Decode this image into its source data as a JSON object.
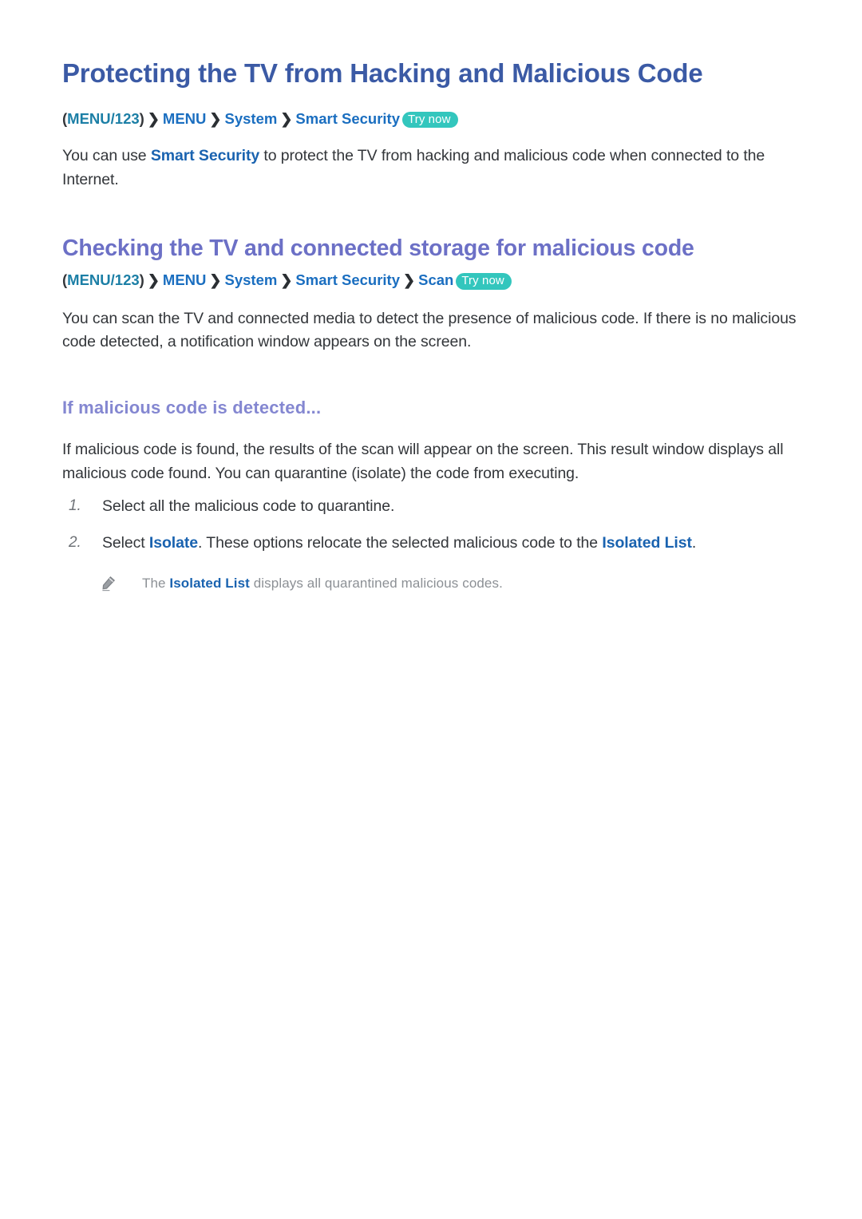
{
  "colors": {
    "title_blue": "#3b5aa5",
    "section_purple": "#6c70c6",
    "subsection_purple": "#8487d1",
    "breadcrumb_teal": "#1c7fa6",
    "breadcrumb_blue": "#1a6ec0",
    "link_blue": "#1a63b0",
    "body_text": "#33363a",
    "note_text": "#8c9095",
    "badge_teal": "#33c6bd",
    "page_background": "#ffffff"
  },
  "title": "Protecting the TV from Hacking and Malicious Code",
  "breadcrumb_1": {
    "open_paren": "(",
    "key": "MENU/123",
    "close_paren": ")",
    "separator": "❯",
    "items": [
      "MENU",
      "System",
      "Smart Security"
    ],
    "badge": "Try now"
  },
  "intro": {
    "part1": "You can use ",
    "link": "Smart Security",
    "part2": " to protect the TV from hacking and malicious code when connected to the Internet."
  },
  "section": {
    "heading": "Checking the TV and connected storage for malicious code",
    "breadcrumb_2": {
      "open_paren": "(",
      "key": "MENU/123",
      "close_paren": ")",
      "separator": "❯",
      "items": [
        "MENU",
        "System",
        "Smart Security",
        "Scan"
      ],
      "badge": "Try now"
    },
    "paragraph": "You can scan the TV and connected media to detect the presence of malicious code. If there is no malicious code detected, a notification window appears on the screen."
  },
  "subsection": {
    "heading": "If malicious code is detected...",
    "paragraph": "If malicious code is found, the results of the scan will appear on the screen. This result window displays all malicious code found. You can quarantine (isolate) the code from executing.",
    "steps": [
      {
        "number": "1.",
        "part1": "Select all the malicious code to quarantine.",
        "link1": "",
        "part2": "",
        "link2": "",
        "part3": ""
      },
      {
        "number": "2.",
        "part1": "Select ",
        "link1": "Isolate",
        "part2": ". These options relocate the selected malicious code to the ",
        "link2": "Isolated List",
        "part3": "."
      }
    ],
    "note": {
      "icon": "pencil-icon",
      "part1": "The ",
      "link": "Isolated List",
      "part2": " displays all quarantined malicious codes."
    }
  }
}
